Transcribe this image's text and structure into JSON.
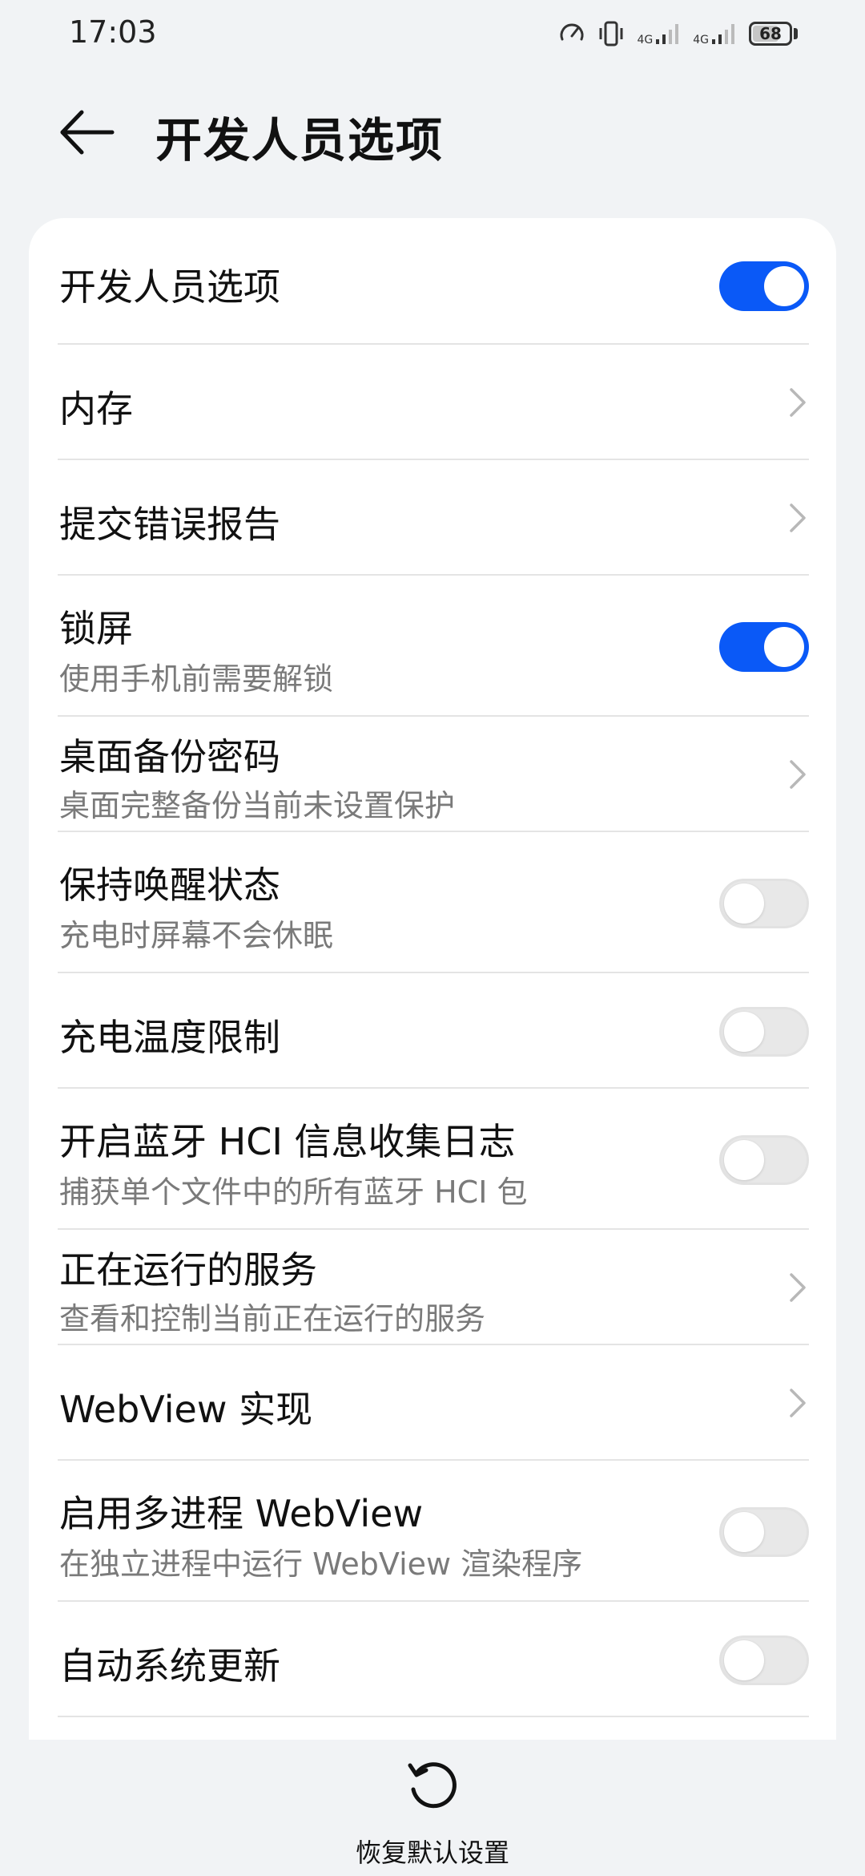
{
  "status_bar": {
    "time": "17:03",
    "network_1": "4G",
    "network_2": "4G",
    "battery": "68"
  },
  "header": {
    "title": "开发人员选项"
  },
  "settings": [
    {
      "title": "开发人员选项",
      "control": "toggle",
      "on": true
    },
    {
      "title": "内存",
      "control": "chevron"
    },
    {
      "title": "提交错误报告",
      "control": "chevron"
    },
    {
      "title": "锁屏",
      "subtitle": "使用手机前需要解锁",
      "control": "toggle",
      "on": true
    },
    {
      "title": "桌面备份密码",
      "subtitle": "桌面完整备份当前未设置保护",
      "control": "chevron"
    },
    {
      "title": "保持唤醒状态",
      "subtitle": "充电时屏幕不会休眠",
      "control": "toggle",
      "on": false
    },
    {
      "title": "充电温度限制",
      "control": "toggle",
      "on": false
    },
    {
      "title": "开启蓝牙 HCI 信息收集日志",
      "subtitle": "捕获单个文件中的所有蓝牙 HCI 包",
      "control": "toggle",
      "on": false
    },
    {
      "title": "正在运行的服务",
      "subtitle": "查看和控制当前正在运行的服务",
      "control": "chevron"
    },
    {
      "title": "WebView 实现",
      "control": "chevron"
    },
    {
      "title": "启用多进程 WebView",
      "subtitle": "在独立进程中运行 WebView 渲染程序",
      "control": "toggle",
      "on": false
    },
    {
      "title": "自动系统更新",
      "control": "toggle",
      "on": false
    }
  ],
  "bottom_bar": {
    "reset_label": "恢复默认设置"
  },
  "colors": {
    "accent": "#0a59f7",
    "background": "#f1f3f5",
    "card": "#ffffff"
  }
}
